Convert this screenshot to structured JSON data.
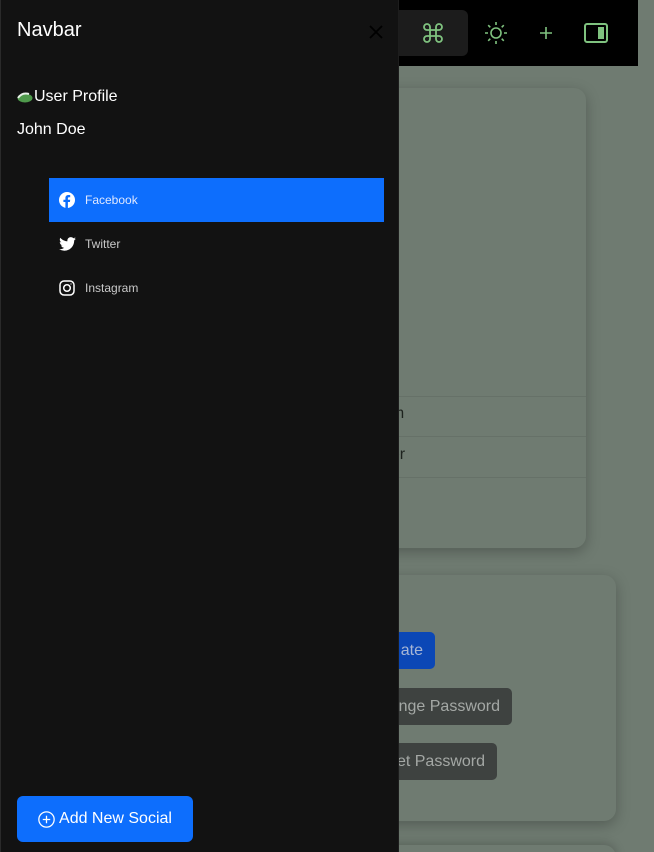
{
  "drawer": {
    "title": "Navbar",
    "profile_image_alt": "User Profile",
    "user_name": "John Doe",
    "nav_items": [
      {
        "label": "Facebook",
        "icon": "facebook-icon",
        "active": true
      },
      {
        "label": "Twitter",
        "icon": "twitter-icon",
        "active": false
      },
      {
        "label": "Instagram",
        "icon": "instagram-icon",
        "active": false
      }
    ],
    "add_button_label": "Add New Social"
  },
  "background": {
    "profile_rows": [
      "om",
      "per"
    ],
    "update_button": "ate",
    "change_password_button": "nge Password",
    "reset_password_button": "et Password"
  },
  "colors": {
    "primary": "#0d6efd",
    "drawer_bg": "#121212",
    "overlay_tint": "#6f7b71"
  }
}
